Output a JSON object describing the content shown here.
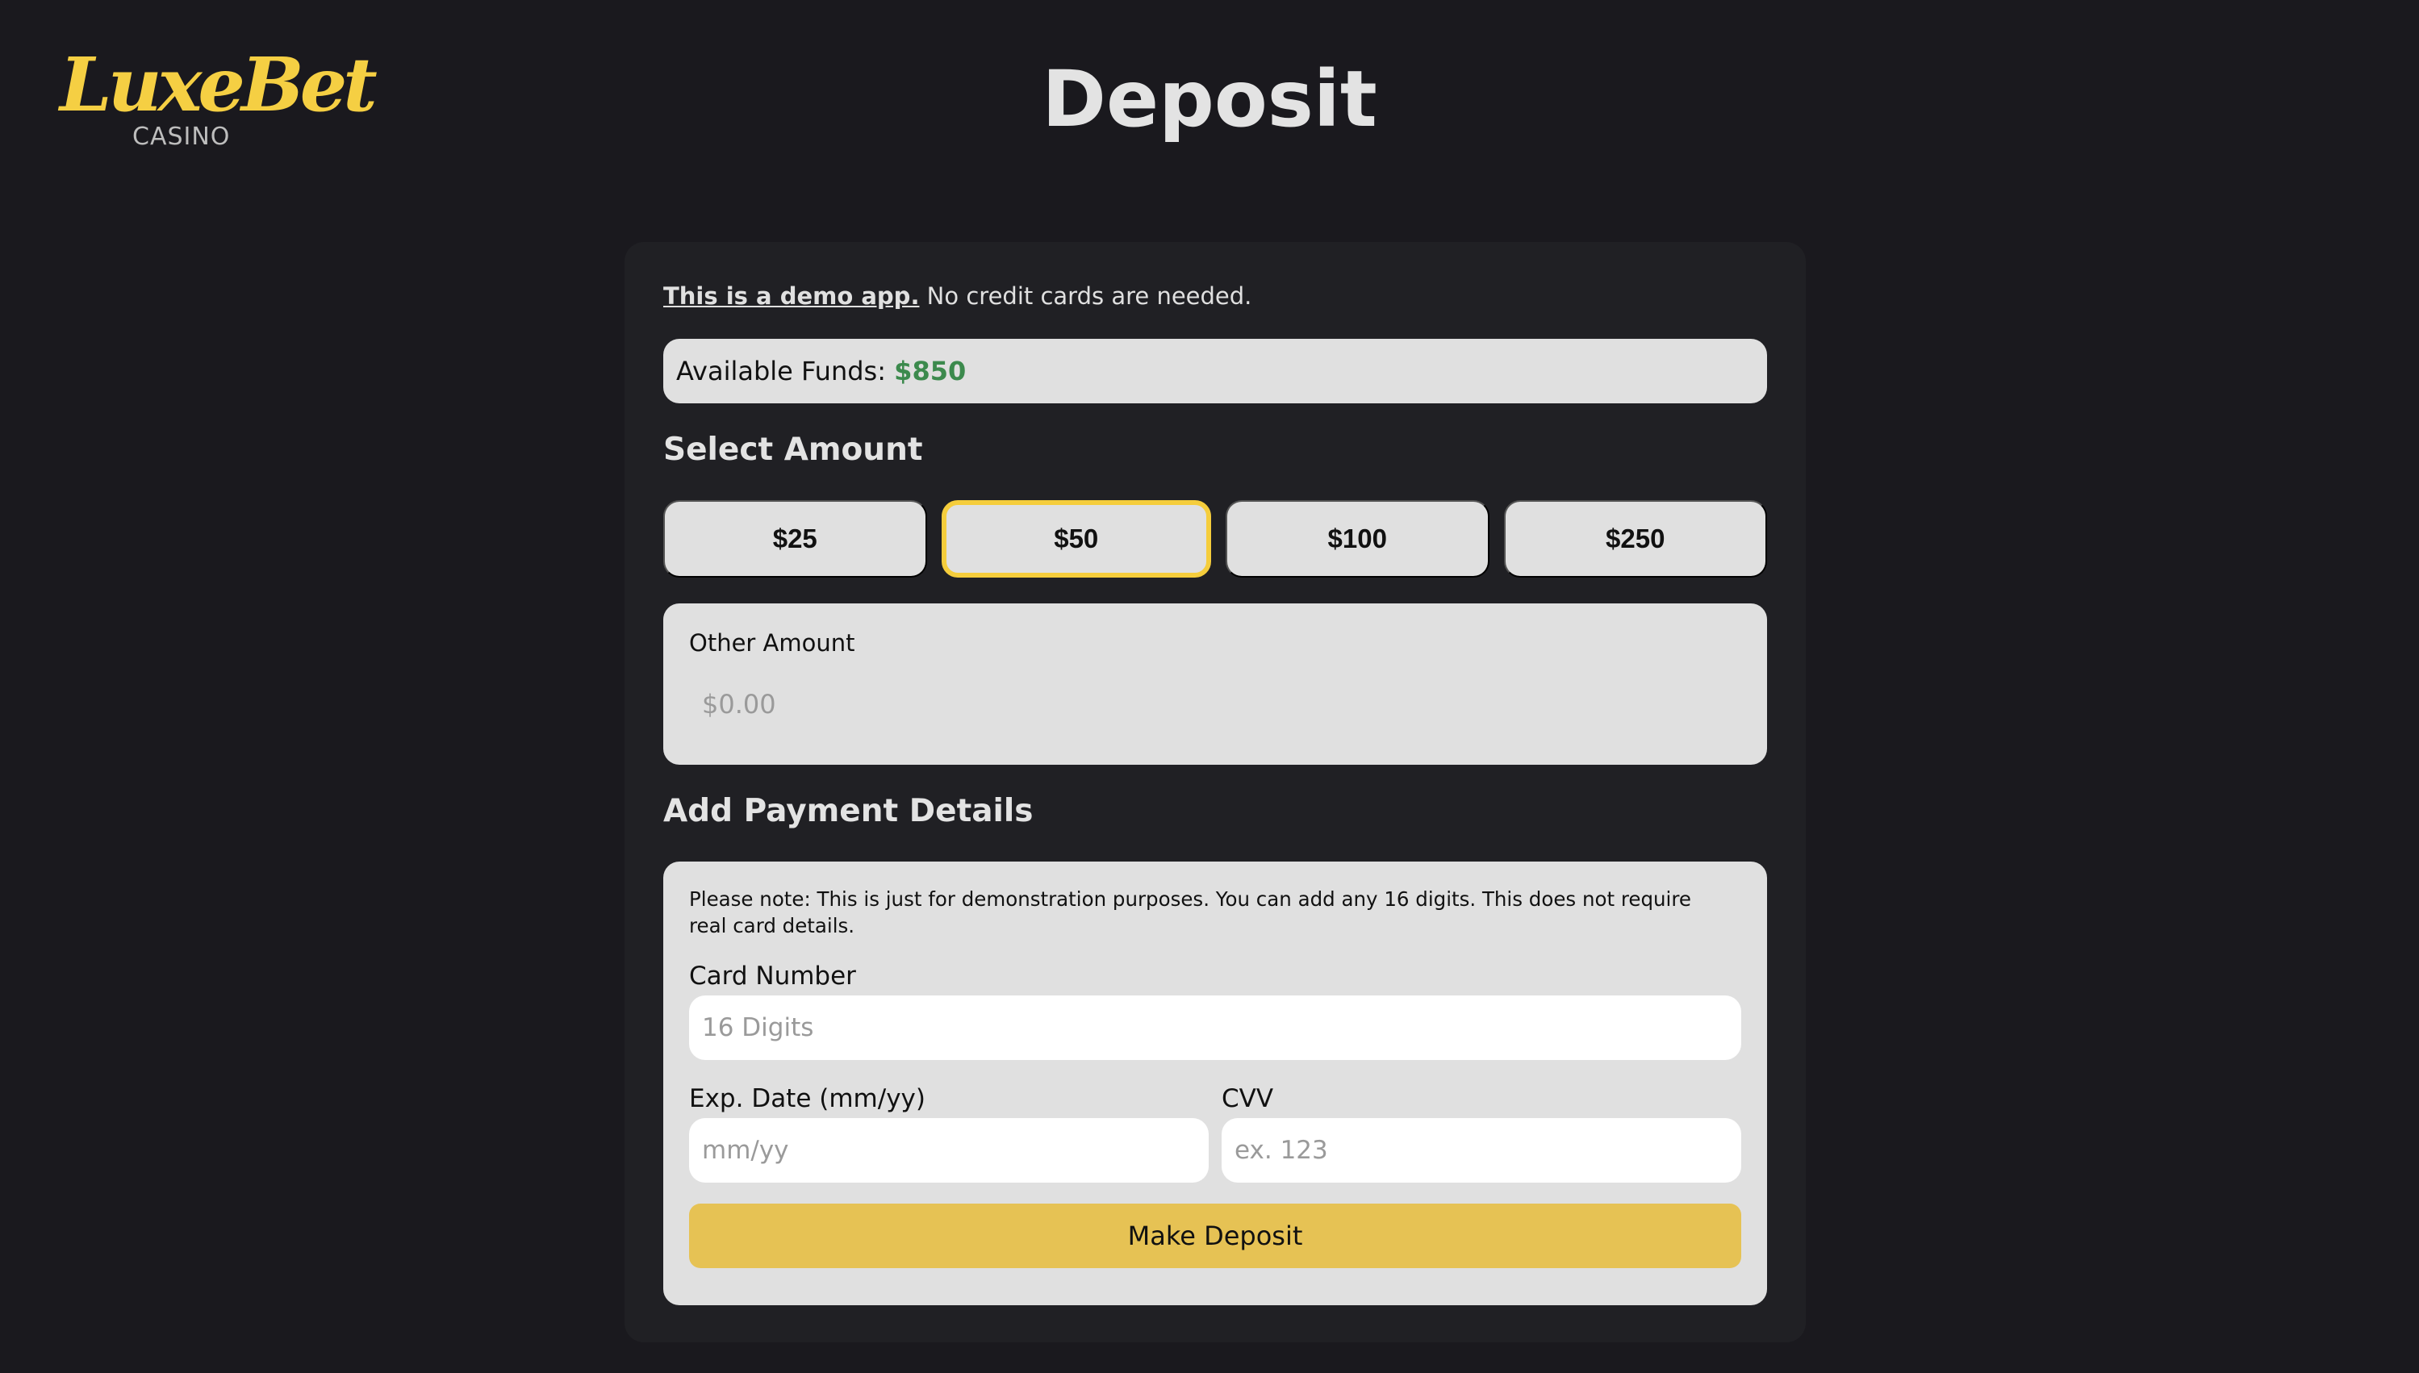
{
  "brand": {
    "name": "LuxeBet",
    "sub": "CASINO",
    "color": "#f5cf43"
  },
  "page_title": "Deposit",
  "demo": {
    "link_text": "This is a demo app.",
    "text": " No credit cards are needed."
  },
  "funds": {
    "label": "Available Funds: ",
    "value": "$850",
    "value_color": "#3c8a4d"
  },
  "select_amount": {
    "heading": "Select Amount",
    "options": [
      "$25",
      "$50",
      "$100",
      "$250"
    ],
    "selected": "$50",
    "selected_border_color": "#f5cd3c"
  },
  "other_amount": {
    "label": "Other Amount",
    "placeholder": "$0.00",
    "value": ""
  },
  "payment": {
    "heading": "Add Payment Details",
    "note": "Please note: This is just for demonstration purposes. You can add any 16 digits. This does not require real card details.",
    "card_number": {
      "label": "Card Number",
      "placeholder": "16 Digits",
      "value": ""
    },
    "exp_date": {
      "label": "Exp. Date (mm/yy)",
      "placeholder": "mm/yy",
      "value": ""
    },
    "cvv": {
      "label": "CVV",
      "placeholder": "ex. 123",
      "value": ""
    },
    "submit_label": "Make Deposit",
    "submit_color": "#e6c254"
  }
}
